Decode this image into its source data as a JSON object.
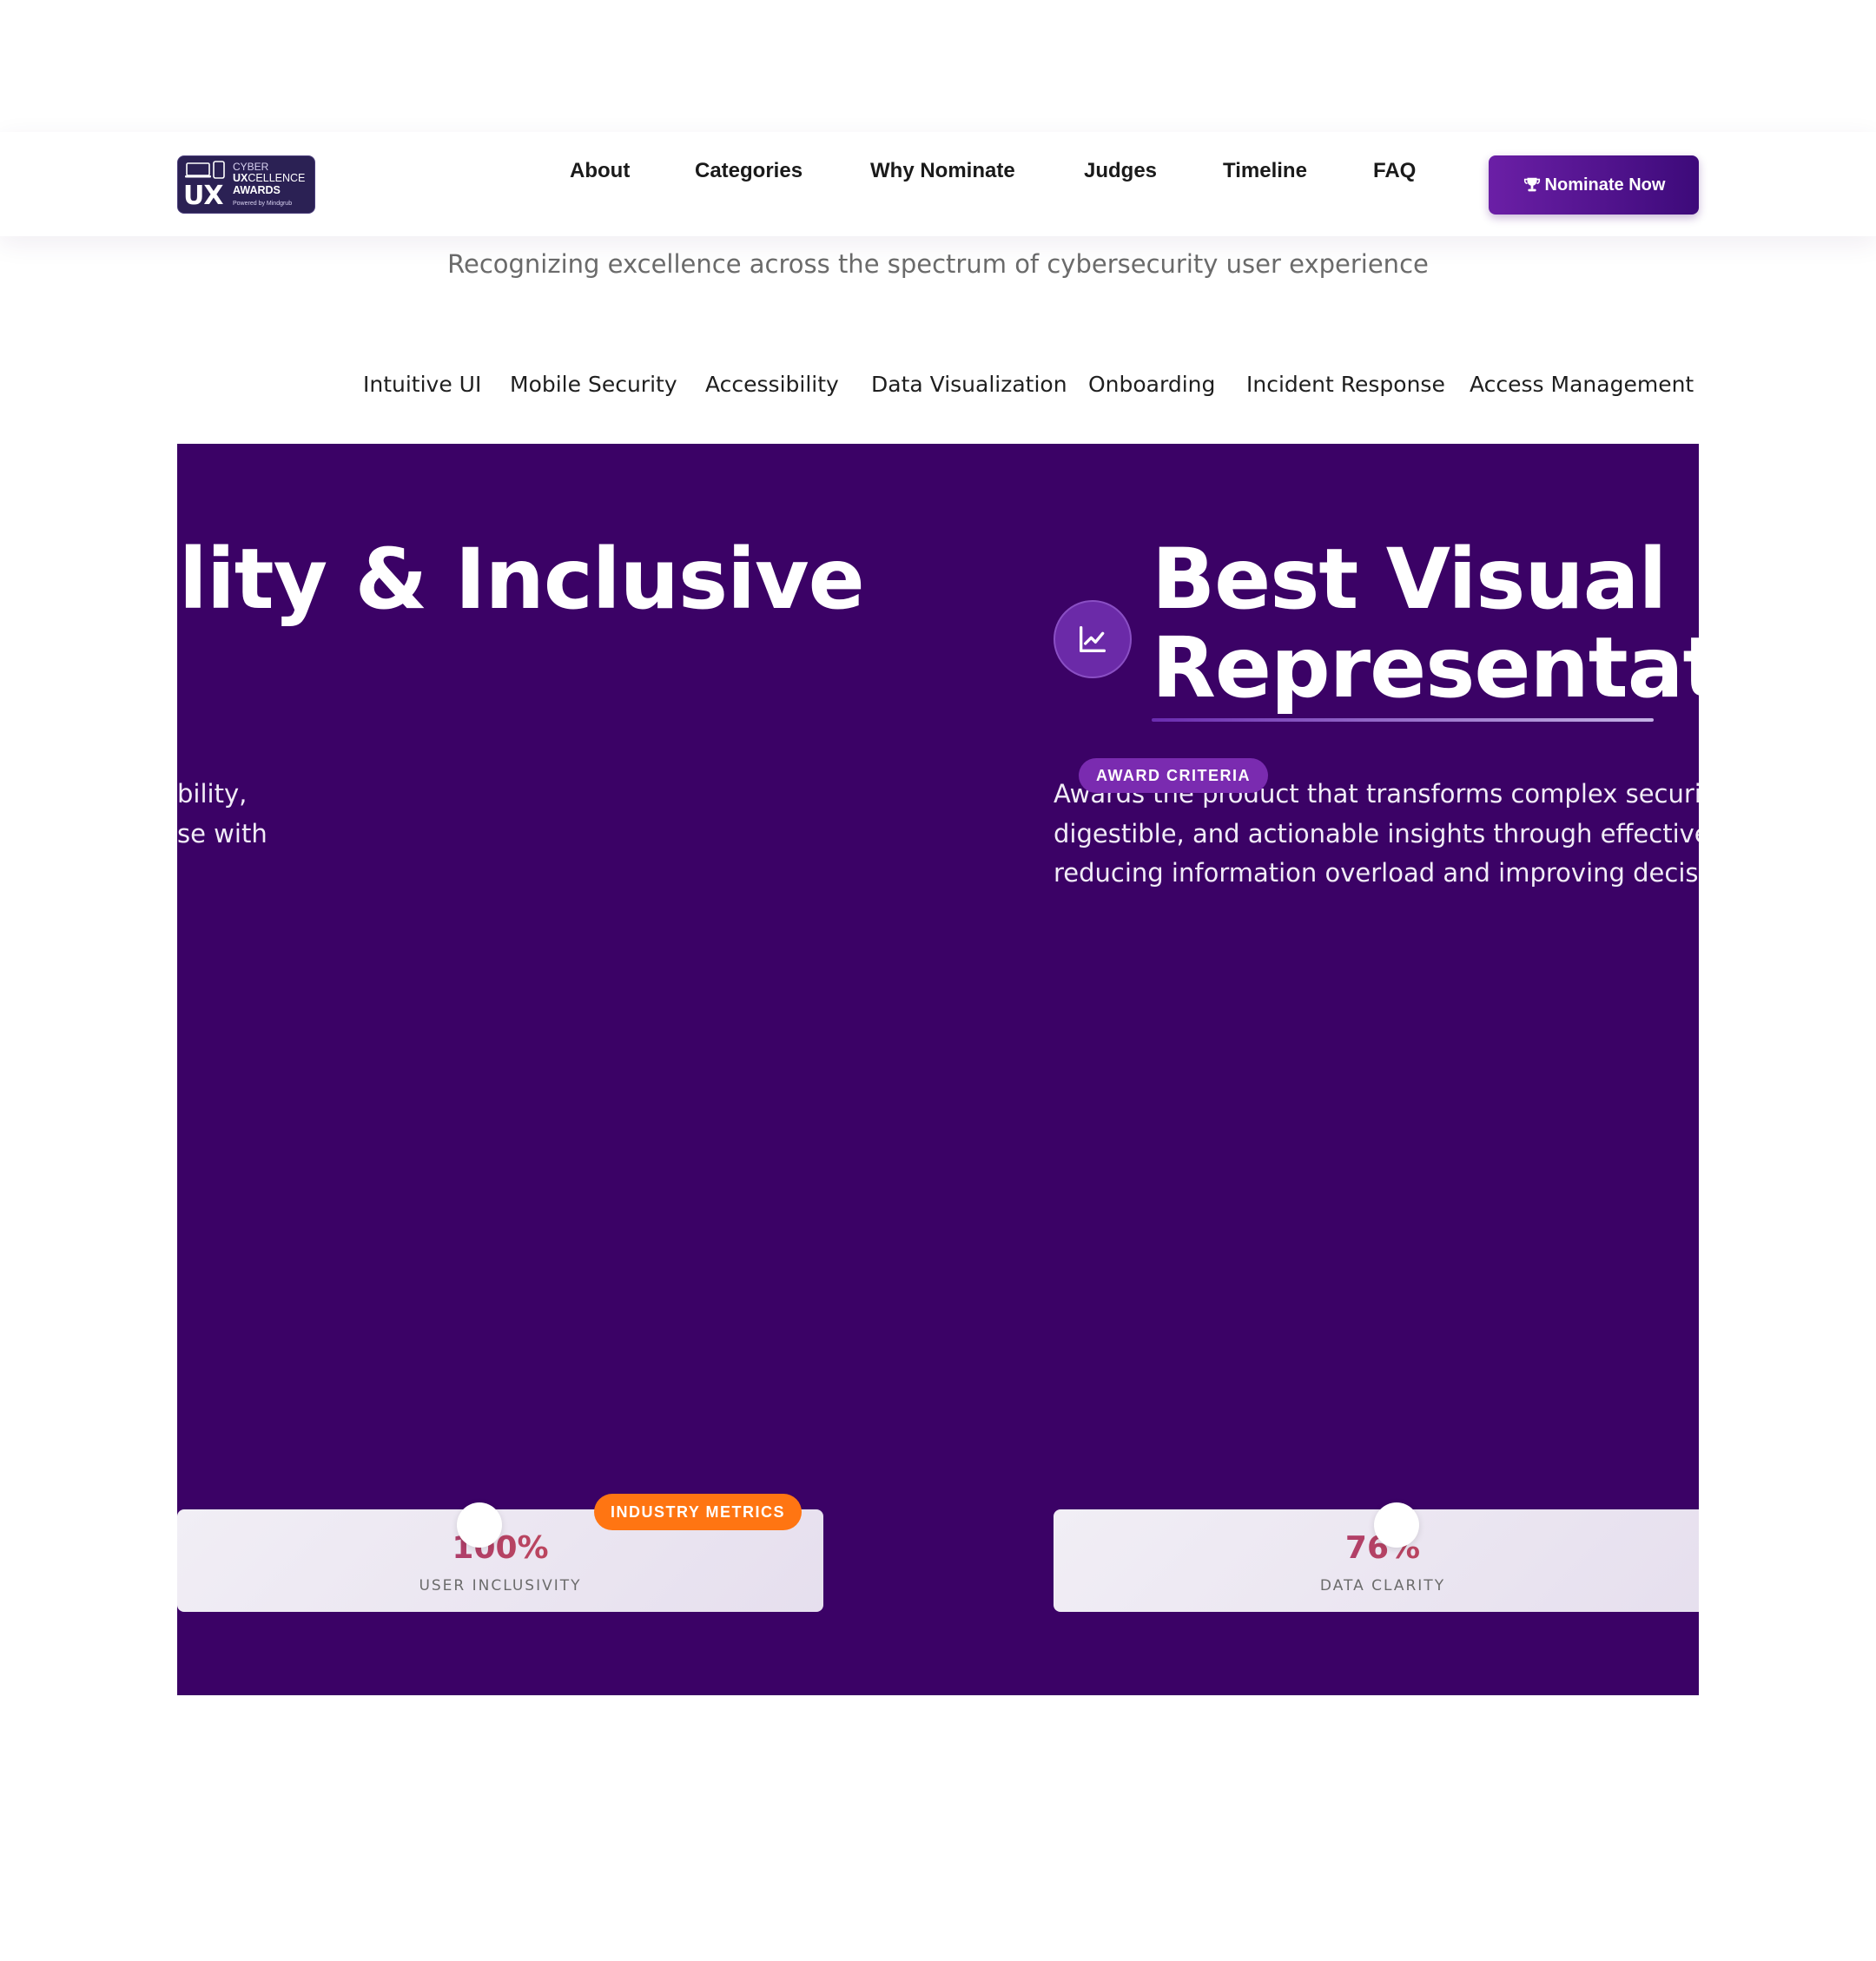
{
  "nav": {
    "logo": {
      "line1": "CYBER",
      "line2_bold": "UX",
      "line2_rest": "CELLENCE",
      "line3": "AWARDS",
      "line4": "Powered by Mindgrub",
      "mark": "UX"
    },
    "links": [
      "About",
      "Categories",
      "Why Nominate",
      "Judges",
      "Timeline",
      "FAQ"
    ],
    "cta": {
      "label": "Nominate Now",
      "icon": "trophy-icon"
    }
  },
  "subtitle": "Recognizing excellence across the spectrum of cybersecurity user experience",
  "tabs": [
    "Intuitive UI",
    "Mobile Security",
    "Accessibility",
    "Data Visualization",
    "Onboarding",
    "Incident Response",
    "Access Management"
  ],
  "carousel": {
    "background": "#3b0266",
    "cards": [
      {
        "title_line1": "ility & Inclusive",
        "desc_line1": "bility,",
        "desc_line2": "se with",
        "badge": "INDUSTRY METRICS",
        "metric_value": "100%",
        "metric_label": "USER INCLUSIVITY"
      },
      {
        "icon": "line-chart-icon",
        "title_line1": "Best Visual D",
        "title_line2": "Representati",
        "criteria": "AWARD CRITERIA",
        "desc_line1": "Awards the product that transforms complex security d",
        "desc_line2": "digestible, and actionable insights through effective da",
        "desc_line3": "reducing information overload and improving decision",
        "metric_value": "76%",
        "metric_label": "DATA CLARITY"
      }
    ]
  },
  "colors": {
    "accent_purple": "#3b0266",
    "button_gradient": [
      "#6b1fa6",
      "#3d0a7a"
    ],
    "badge_orange": "#ff7512"
  }
}
